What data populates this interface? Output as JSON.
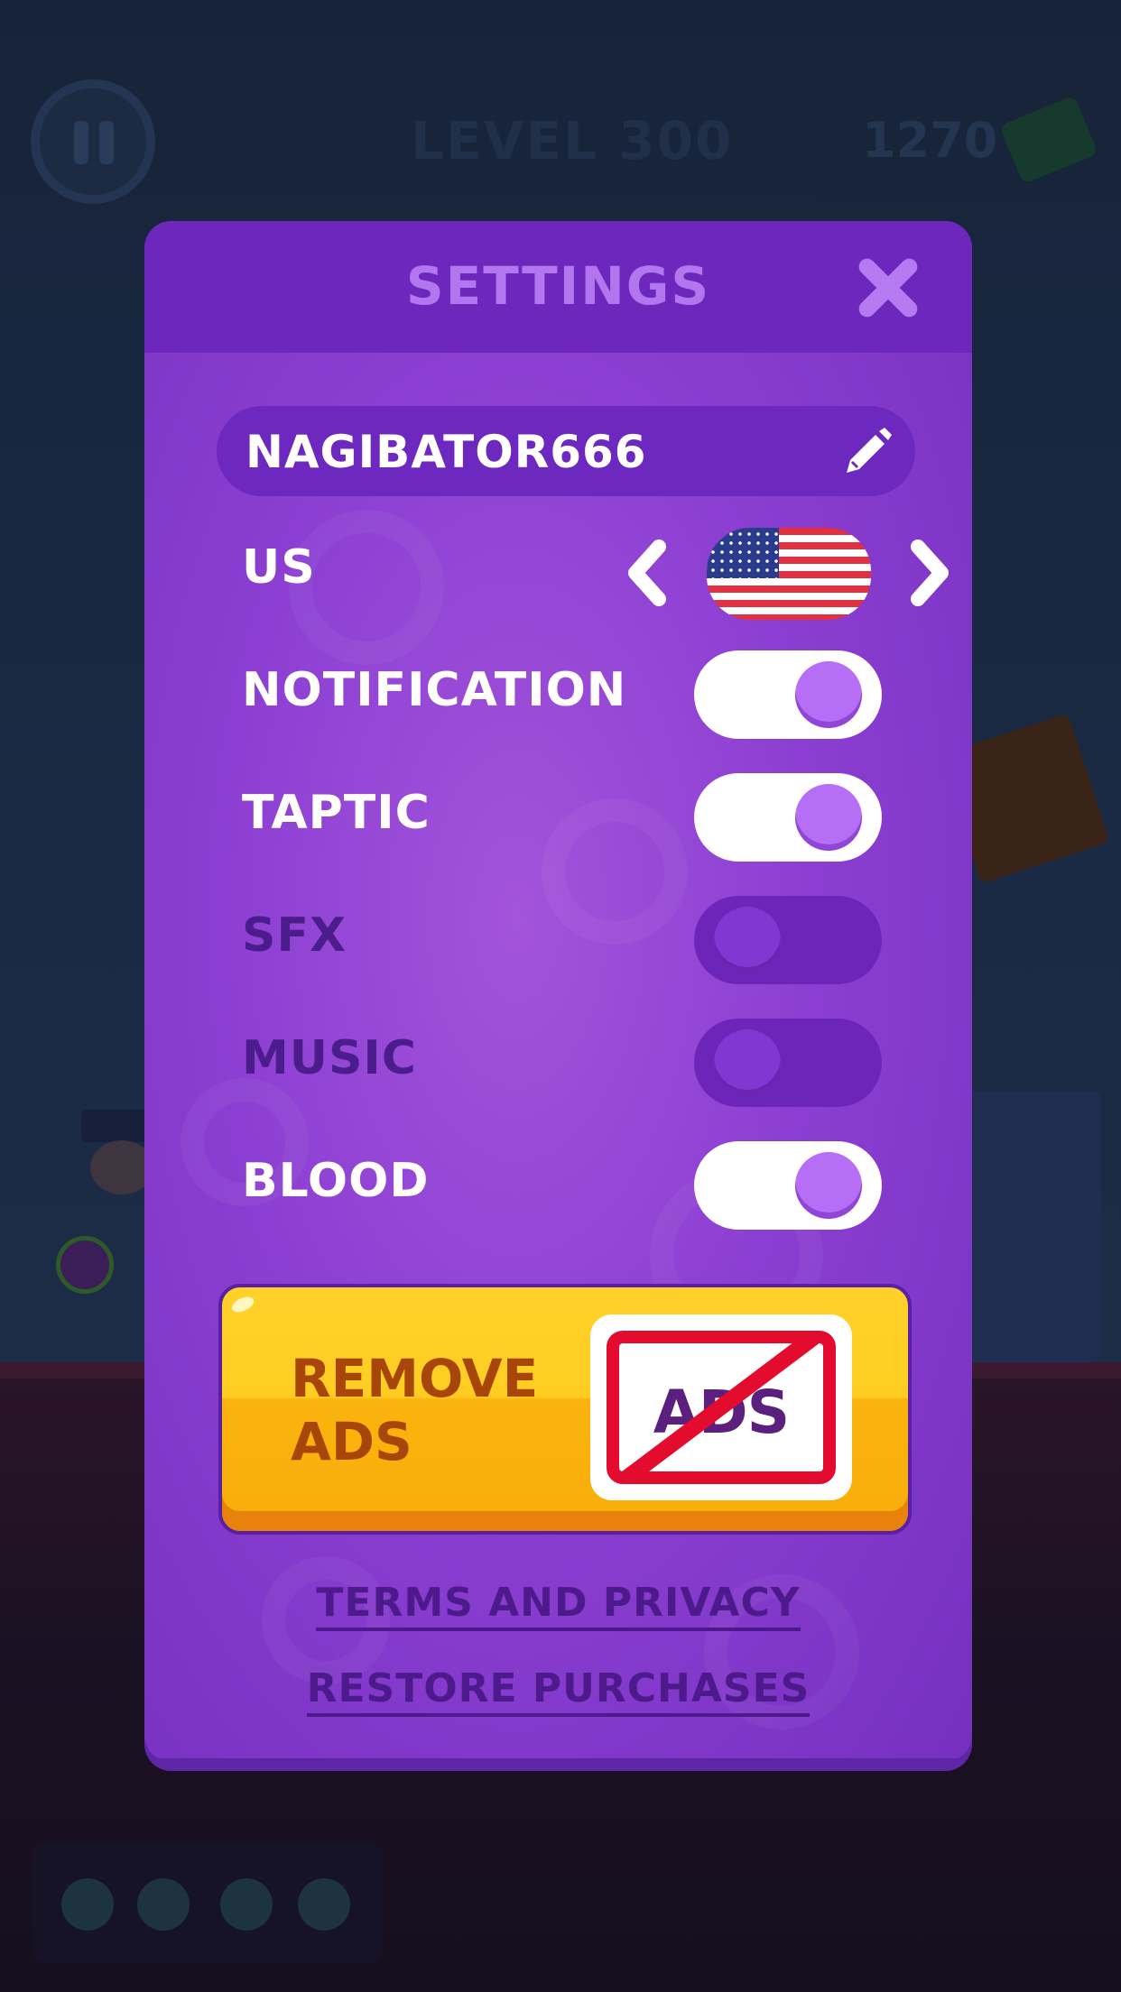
{
  "hud": {
    "level_text": "LEVEL 300",
    "money": "1270",
    "pause_icon": "pause-icon",
    "money_icon": "cash-icon"
  },
  "settings": {
    "title": "SETTINGS",
    "close_icon": "close-icon",
    "username": "NAGIBATOR666",
    "edit_icon": "pencil-icon",
    "country": {
      "code": "US",
      "flag_icon": "us-flag-icon",
      "prev_icon": "chevron-left-icon",
      "next_icon": "chevron-right-icon"
    },
    "toggles": [
      {
        "label": "NOTIFICATION",
        "on": true
      },
      {
        "label": "TAPTIC",
        "on": true
      },
      {
        "label": "SFX",
        "on": false
      },
      {
        "label": "MUSIC",
        "on": false
      },
      {
        "label": "BLOOD",
        "on": true
      }
    ],
    "remove_ads": {
      "line1": "REMOVE",
      "line2": "ADS",
      "badge_text": "ADS",
      "badge_icon": "no-ads-icon"
    },
    "links": {
      "terms": "TERMS AND PRIVACY",
      "restore": "RESTORE PURCHASES"
    }
  },
  "colors": {
    "panel": "#8c3fd2",
    "panel_header": "#6d27bd",
    "toggle_on_knob": "#b56ef5",
    "remove_ads_button": "#fbb30e",
    "no_ads_red": "#e30c2f"
  }
}
